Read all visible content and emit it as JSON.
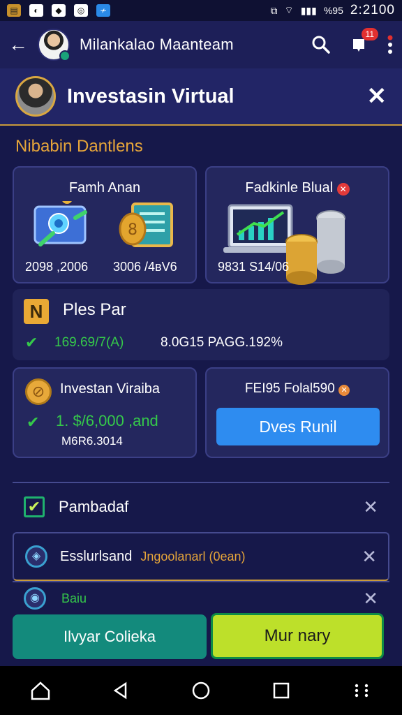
{
  "status": {
    "time": "2:2100",
    "battery": "%95"
  },
  "appbar": {
    "title": "Milankalao Maanteam",
    "badge": "11"
  },
  "header": {
    "title": "Investasin Virtual"
  },
  "section": {
    "title": "Nibabin Dantlens"
  },
  "card1": {
    "title": "Famh Anan",
    "value1": "2098 ,2006",
    "value2": "3006 /4вV6"
  },
  "card2": {
    "title": "Fadkinle Blual",
    "value": "9831 S14/06"
  },
  "card3": {
    "title": "Ples Par",
    "metric1": "169.69/7(A)",
    "metric2": "8.0G15 PAGG.192%"
  },
  "card4": {
    "title": "Investan Viraiba",
    "amount": "1. $/6,000 ,and",
    "sub": "M6R6.3014"
  },
  "card5": {
    "title": "FEI95 Folal590",
    "button": "Dves Runil"
  },
  "rows": [
    {
      "label": "Pambadaf",
      "extra": ""
    },
    {
      "label": "Esslurlsand",
      "extra": "Jngoolanarl (0ean)"
    },
    {
      "label": "Baiu",
      "extra": ""
    }
  ],
  "buttons": {
    "left": "Ilvyar Colieka",
    "right": "Mur nary"
  },
  "colors": {
    "accent": "#e6a53a",
    "green": "#35c94a",
    "primary_button": "#2e8cf0",
    "lime": "#bde02a",
    "teal": "#138a7c"
  }
}
